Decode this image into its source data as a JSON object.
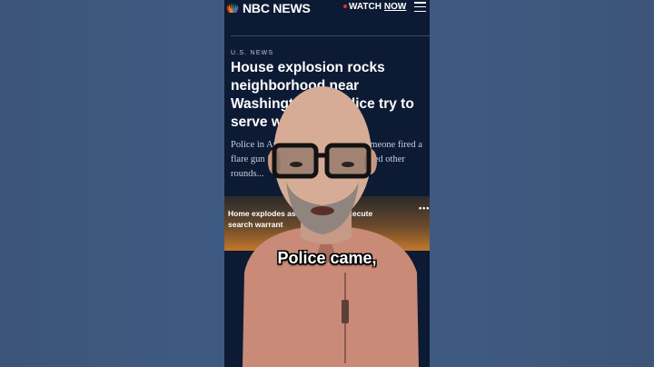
{
  "header": {
    "logo_text": "NBC NEWS",
    "watch_label": "WATCH",
    "now_label": "NOW"
  },
  "article": {
    "section": "U.S. NEWS",
    "headline": "House explosion rocks neighborhood near Washington as police try to serve warrant",
    "dek": "Police in Arlington, Virginia, said someone fired a flare gun inside the home and then fired other rounds..."
  },
  "video": {
    "caption": "Home explodes as police try to execute search warrant",
    "more_label": "•••"
  },
  "subtitle": "Police came,",
  "colors": {
    "background": "#3f5a82",
    "phone_bg": "#0d1a33",
    "shirt": "#c98a78",
    "accent_red": "#e1322f"
  }
}
